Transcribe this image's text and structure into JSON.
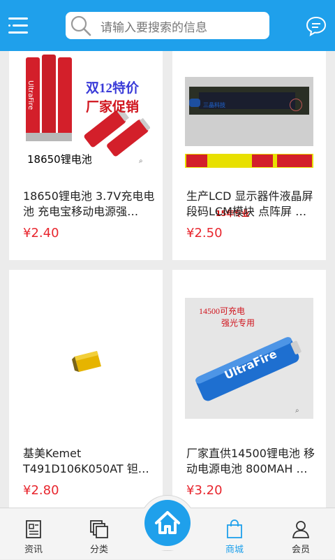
{
  "header": {
    "search_placeholder": "请输入要搜索的信息"
  },
  "products": [
    {
      "title": "18650锂电池 3.7V充电电池 充电宝移动电源强…",
      "price": "¥2.40",
      "image_caption": "18650锂电池",
      "promo_line1": "双12特价",
      "promo_line2": "厂家促销",
      "brand": "UltraFire"
    },
    {
      "title": "生产LCD 显示器件液晶屏段码LCM模块 点阵屏 …",
      "price": "¥2.50",
      "banner_items": [
        "定制",
        "15年专业",
        "厂家",
        "工厂直销"
      ],
      "logo_text": "三晶科技"
    },
    {
      "title": "基美Kemet T491D106K050AT 钽…",
      "price": "¥2.80"
    },
    {
      "title": "厂家直供14500锂电池 移动电源电池 800MAH …",
      "price": "¥3.20",
      "image_caption_1": "14500可充电",
      "image_caption_2": "强光专用",
      "brand": "UltraFire"
    }
  ],
  "bottom_nav": {
    "tabs": [
      {
        "label": "资讯",
        "icon": "news-icon"
      },
      {
        "label": "分类",
        "icon": "category-icon"
      },
      {
        "label": "商城",
        "icon": "shop-bag-icon",
        "active": true
      },
      {
        "label": "会员",
        "icon": "member-icon"
      }
    ],
    "home_icon": "home-icon"
  },
  "colors": {
    "accent": "#1fa0eb",
    "price": "#e8262e"
  }
}
